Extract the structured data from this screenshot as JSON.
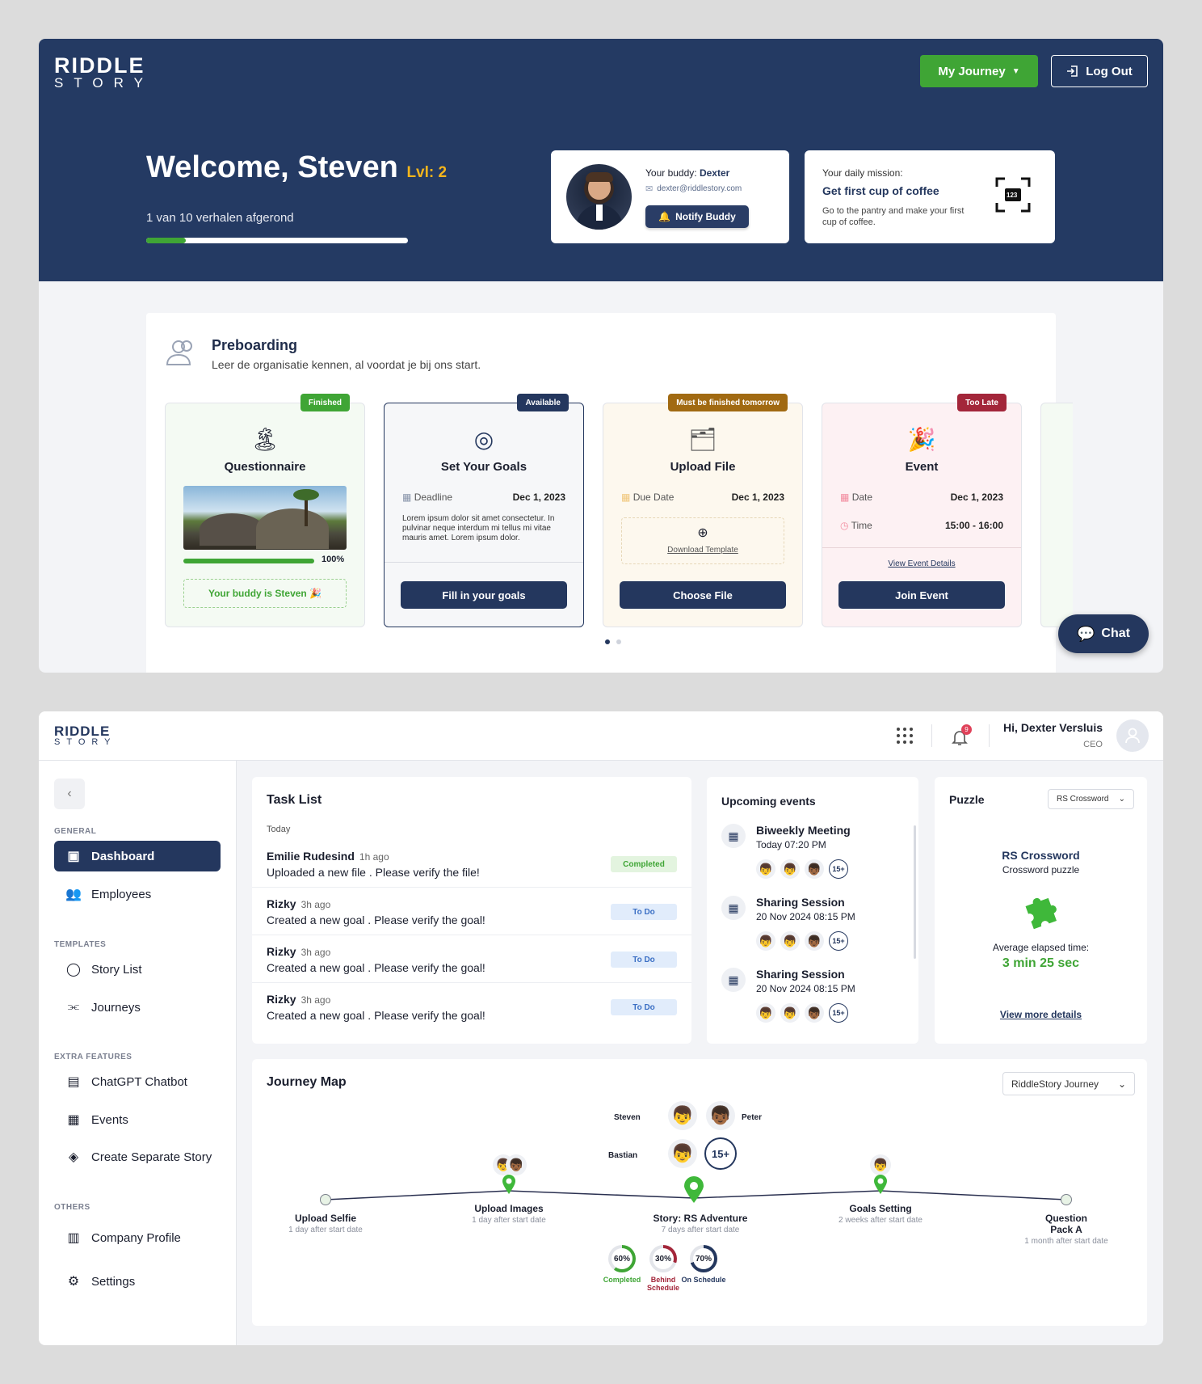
{
  "brand": {
    "logo_top": "RIDDLE",
    "logo_bottom": "STORY"
  },
  "hero": {
    "journey_button": "My Journey",
    "logout_button": "Log Out",
    "welcome": "Welcome, Steven",
    "level": "Lvl: 2",
    "stories_done": "1 van 10 verhalen afgerond",
    "progress_fraction": 0.15
  },
  "buddy": {
    "label": "Your buddy:",
    "name": "Dexter",
    "email": "dexter@riddlestory.com",
    "notify_button": "Notify Buddy"
  },
  "mission": {
    "label": "Your daily mission:",
    "title": "Get first cup of coffee",
    "desc": "Go to the pantry and make your first cup of coffee.",
    "scan_text": "123"
  },
  "preboarding": {
    "title": "Preboarding",
    "subtitle": "Leer de organisatie kennen, al voordat je bij ons start.",
    "cards": [
      {
        "badge": "Finished",
        "title": "Questionnaire",
        "progress": "100%",
        "buddy_note": "Your buddy is Steven 🎉"
      },
      {
        "badge": "Available",
        "title": "Set Your Goals",
        "k1": "Deadline",
        "v1": "Dec 1, 2023",
        "body": "Lorem ipsum dolor sit amet consectetur. In pulvinar neque interdum mi tellus mi vitae mauris amet. Lorem ipsum dolor.",
        "button": "Fill in your goals"
      },
      {
        "badge": "Must be finished tomorrow",
        "title": "Upload File",
        "k1": "Due Date",
        "v1": "Dec 1, 2023",
        "download": "Download Template",
        "button": "Choose File"
      },
      {
        "badge": "Too Late",
        "title": "Event",
        "k1": "Date",
        "v1": "Dec 1, 2023",
        "k2": "Time",
        "v2": "15:00 - 16:00",
        "link": "View Event Details",
        "button": "Join Event"
      }
    ]
  },
  "chat": {
    "label": "Chat"
  },
  "dashboard": {
    "greeting": "Hi, Dexter Versluis",
    "role": "CEO",
    "notif_count": "9",
    "sidebar": {
      "general": "GENERAL",
      "templates": "TEMPLATES",
      "extra": "EXTRA FEATURES",
      "others": "OTHERS",
      "items": [
        "Dashboard",
        "Employees",
        "Story List",
        "Journeys",
        "ChatGPT Chatbot",
        "Events",
        "Create Separate Story",
        "Company Profile",
        "Settings"
      ]
    },
    "tasks": {
      "title": "Task List",
      "today": "Today",
      "rows": [
        {
          "name": "Emilie Rudesind",
          "ago": "1h ago",
          "desc": "Uploaded a new file . Please verify the file!",
          "status": "Completed"
        },
        {
          "name": "Rizky",
          "ago": "3h ago",
          "desc": "Created a new goal . Please verify the goal!",
          "status": "To Do"
        },
        {
          "name": "Rizky",
          "ago": "3h ago",
          "desc": "Created a new goal . Please verify the goal!",
          "status": "To Do"
        },
        {
          "name": "Rizky",
          "ago": "3h ago",
          "desc": "Created a new goal . Please verify the goal!",
          "status": "To Do"
        }
      ]
    },
    "events": {
      "title": "Upcoming events",
      "items": [
        {
          "name": "Biweekly Meeting",
          "when": "Today 07:20 PM",
          "more": "15+"
        },
        {
          "name": "Sharing Session",
          "when": "20 Nov 2024 08:15 PM",
          "more": "15+"
        },
        {
          "name": "Sharing Session",
          "when": "20 Nov 2024 08:15 PM",
          "more": "15+"
        }
      ]
    },
    "puzzle": {
      "title": "Puzzle",
      "select": "RS Crossword",
      "name": "RS Crossword",
      "type": "Crossword puzzle",
      "avg_label": "Average elapsed time:",
      "avg_value": "3 min 25 sec",
      "link": "View more details"
    },
    "journey_map": {
      "title": "Journey Map",
      "select": "RiddleStory Journey",
      "people": [
        "Steven",
        "Peter",
        "Bastian"
      ],
      "more": "15+",
      "milestones": [
        {
          "label": "Upload Selfie",
          "sub": "1 day after start date"
        },
        {
          "label": "Upload Images",
          "sub": "1 day after start date"
        },
        {
          "label": "Story: RS Adventure",
          "sub": "7 days after start date"
        },
        {
          "label": "Goals Setting",
          "sub": "2 weeks after start date"
        },
        {
          "label": "Question Pack A",
          "sub": "1 month after start date"
        }
      ],
      "stats": [
        {
          "value": "60%",
          "label": "Completed",
          "color": "#3fa535"
        },
        {
          "value": "30%",
          "label": "Behind Schedule",
          "color": "#a3263a"
        },
        {
          "value": "70%",
          "label": "On Schedule",
          "color": "#24375e"
        }
      ]
    }
  }
}
